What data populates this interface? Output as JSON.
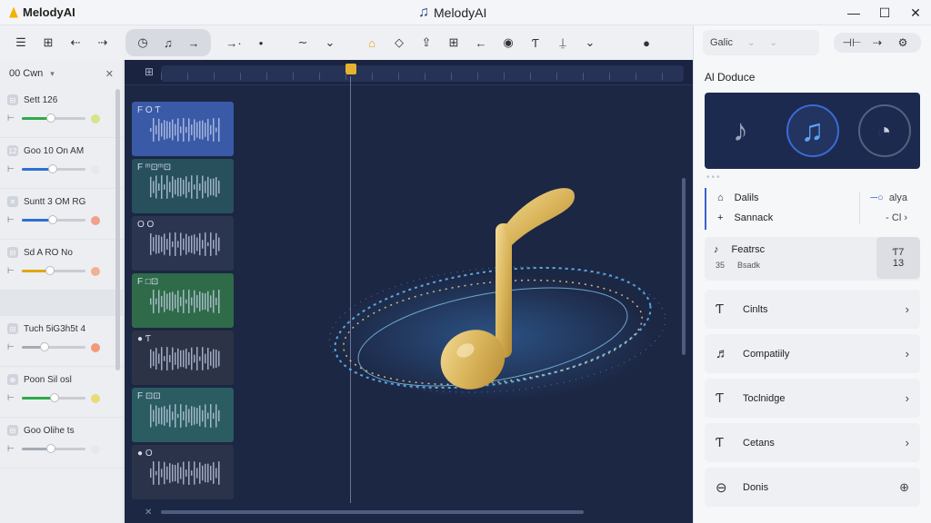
{
  "app": {
    "name": "MelodyAI",
    "title": "MelodyAI"
  },
  "window_controls": {
    "minimize": "—",
    "maximize": "☐",
    "close": "✕"
  },
  "toolbar": {
    "group1": [
      "☰",
      "⊞",
      "⇠",
      "⇢"
    ],
    "transport": [
      "◷",
      "♫",
      "→"
    ],
    "group2": [
      "→·",
      "•",
      "∼",
      "⌄"
    ],
    "group3": [
      "⌂",
      "◇",
      "⇪",
      "⊞",
      "←",
      "◉",
      "Ƭ",
      "⍊",
      "⌄"
    ],
    "record": "●"
  },
  "left_panel": {
    "header": "00 Cwn",
    "tracks": [
      {
        "name": "Sett 126",
        "icon": "⊟",
        "fill_pct": 45,
        "color": "#2eaa4a",
        "dot": "#d8e38a"
      },
      {
        "name": "Goo 10 On AM",
        "icon": "12",
        "fill_pct": 48,
        "color": "#2f6fd6",
        "dot": "#e6e8ec"
      },
      {
        "name": "Suntt 3 OM RG",
        "icon": "✕",
        "fill_pct": 48,
        "color": "#2f6fd6",
        "dot": "#f1a08a"
      },
      {
        "name": "Sd A RO No",
        "icon": "⊟",
        "fill_pct": 44,
        "color": "#e2a70f",
        "dot": "#f0b28f"
      },
      {
        "name": "",
        "icon": "",
        "fill_pct": 0,
        "color": "#c9ccd3",
        "dot": ""
      },
      {
        "name": "Tuch 5iG3h5t 4",
        "icon": "⊟",
        "fill_pct": 36,
        "color": "#a6abb5",
        "dot": "#f19a7a"
      },
      {
        "name": "Poon Sil osl",
        "icon": "⊕",
        "fill_pct": 52,
        "color": "#2eaa4a",
        "dot": "#e7dd75"
      },
      {
        "name": "Goo Olihe ts",
        "icon": "⊟",
        "fill_pct": 46,
        "color": "#a6abb5",
        "dot": "#e6e8ec"
      }
    ]
  },
  "editor": {
    "ruler_icon": "⊞",
    "corner": "✕",
    "lanes": [
      {
        "label": "F  O  Ƭ",
        "bg": "#3a5aa8"
      },
      {
        "label": "F  ᵐ⊡ᵐ⊡",
        "bg": "#27505c"
      },
      {
        "label": "O  O",
        "bg": "#2b3550"
      },
      {
        "label": "F  □⊡",
        "bg": "#2f6b49"
      },
      {
        "label": "●  Ƭ",
        "bg": "#2c3346"
      },
      {
        "label": "F  ⊡⊡",
        "bg": "#2a5c61"
      },
      {
        "label": "●  O",
        "bg": "#2a3349"
      }
    ]
  },
  "right_panel": {
    "search": {
      "value": "Galic"
    },
    "tools": [
      "⊣⊢",
      "⇢",
      "⚙"
    ],
    "section_title": "Al Doduce",
    "ai_buttons": [
      "♪",
      "♫",
      "◔"
    ],
    "details": {
      "item1": "Dalils",
      "item2": "Sannack",
      "right1": "alya",
      "right2": "- Cl  ›"
    },
    "feature": {
      "title": "Featrsc",
      "sub1": "35",
      "sub2": "Bsadk",
      "box_icon": "Ƭ7",
      "box_value": "13"
    },
    "menu": [
      {
        "label": "Cinlts",
        "icon": "Ƭ",
        "trail": "›"
      },
      {
        "label": "Compatiily",
        "icon": "♬",
        "trail": "›"
      },
      {
        "label": "Toclnidge",
        "icon": "Ƭ",
        "trail": "›"
      },
      {
        "label": "Cetans",
        "icon": "Ƭ",
        "trail": "›"
      },
      {
        "label": "Donis",
        "icon": "⊖",
        "trail": "⊕"
      }
    ]
  }
}
